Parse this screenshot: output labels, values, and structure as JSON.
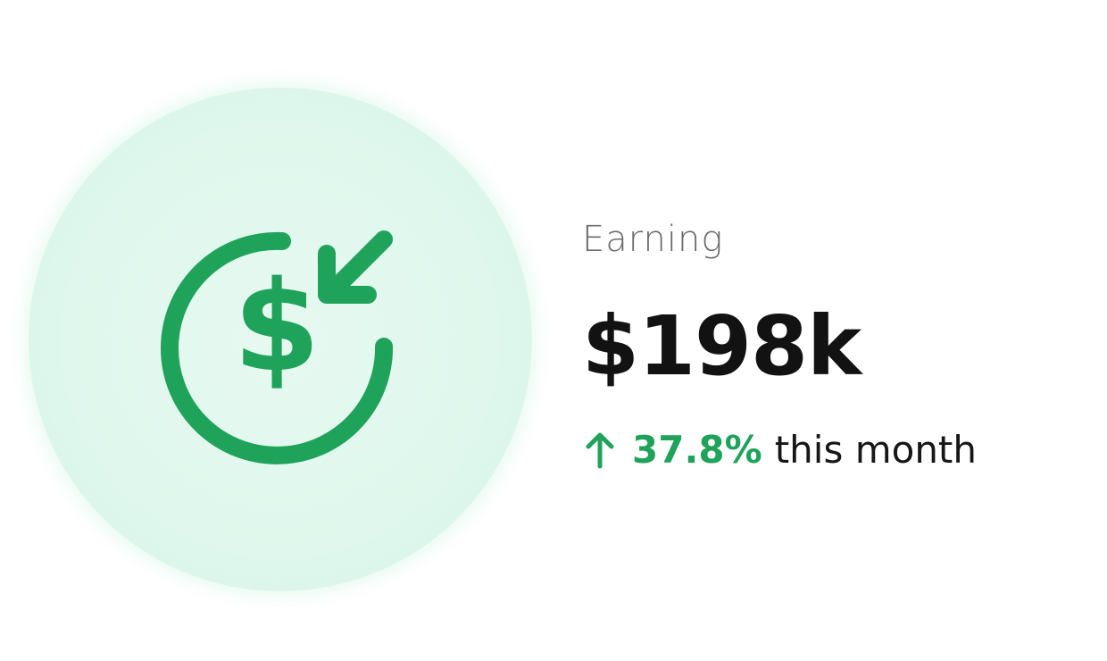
{
  "stat": {
    "label": "Earning",
    "value": "$198k",
    "change_percent": "37.8%",
    "change_suffix": "this month",
    "direction": "up"
  },
  "icons": {
    "main": "dollar-incoming-icon",
    "trend": "arrow-up-icon"
  },
  "colors": {
    "accent": "#1fa35b",
    "circle_bg": "#dff7ec",
    "value_text": "#121212",
    "label_text": "#6b6b6b"
  }
}
